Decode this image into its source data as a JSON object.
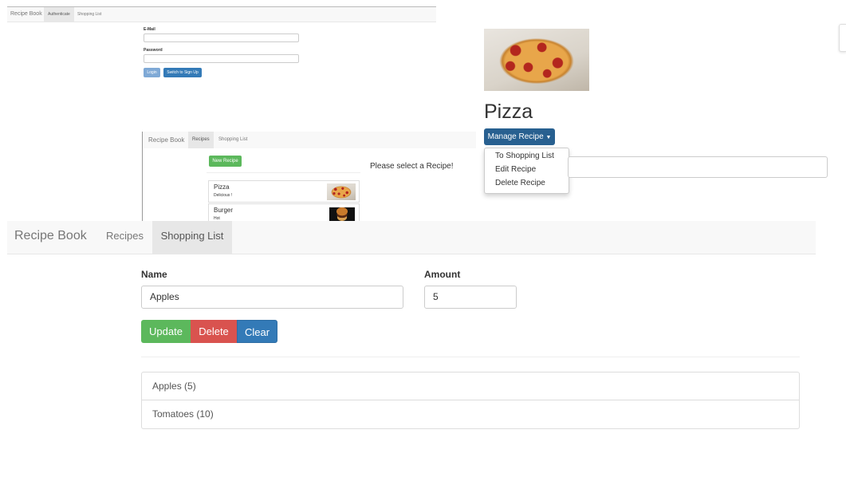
{
  "top_small": {
    "navbar": {
      "brand": "Recipe Book",
      "tabs": [
        "Authenticate",
        "Shopping List"
      ]
    },
    "auth": {
      "email_label": "E-Mail",
      "password_label": "Password",
      "login_label": "Login",
      "switch_label": "Switch to Sign Up"
    }
  },
  "recipe_detail": {
    "title": "Pizza",
    "manage_label": "Manage Recipe",
    "menu": [
      "To Shopping List",
      "Edit Recipe",
      "Delete Recipe"
    ]
  },
  "mid_small": {
    "navbar": {
      "brand": "Recipe Book",
      "tabs": [
        "Recipes",
        "Shopping List"
      ]
    },
    "new_recipe_label": "New Recipe",
    "recipes": [
      {
        "name": "Pizza",
        "description": "Delicious !"
      },
      {
        "name": "Burger",
        "description": "Hot"
      }
    ],
    "placeholder_text": "Please select a Recipe!"
  },
  "main": {
    "navbar": {
      "brand": "Recipe Book",
      "tabs": [
        "Recipes",
        "Shopping List"
      ]
    },
    "form": {
      "name_label": "Name",
      "name_value": "Apples",
      "amount_label": "Amount",
      "amount_value": "5",
      "update_label": "Update",
      "delete_label": "Delete",
      "clear_label": "Clear"
    },
    "items": [
      "Apples (5)",
      "Tomatoes (10)"
    ]
  },
  "colors": {
    "success": "#5cb85c",
    "danger": "#d9534f",
    "primary": "#337ab7",
    "primary_dark": "#286090",
    "navbar_bg": "#f8f8f8",
    "active_tab": "#e7e7e7"
  }
}
